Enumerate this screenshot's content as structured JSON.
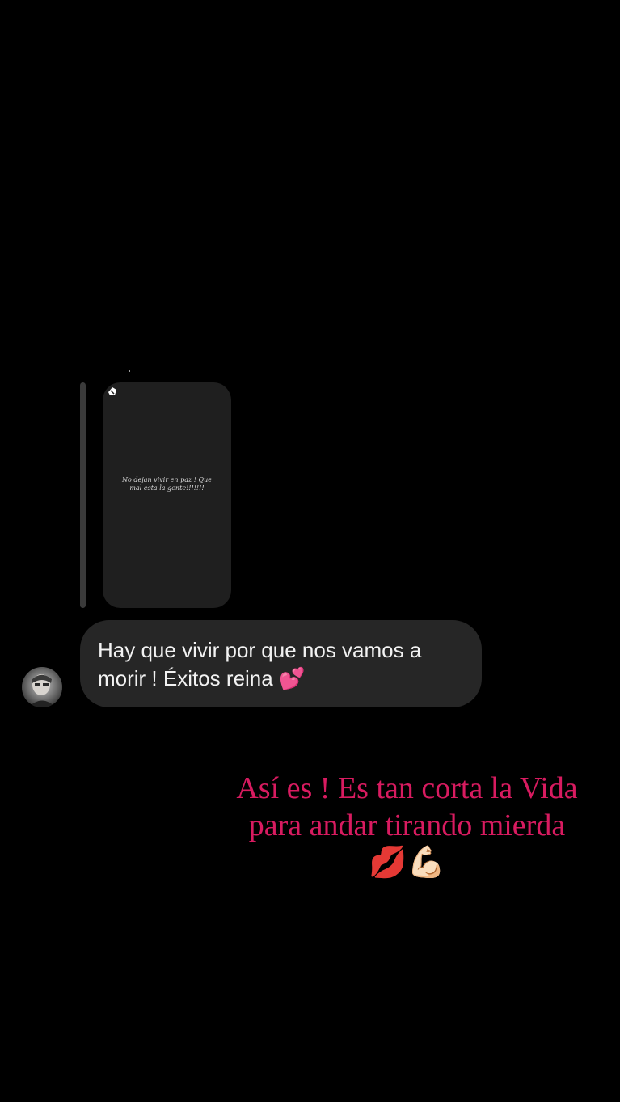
{
  "replied_story": {
    "text": "No dejan vivir en paz ! Que mal esta la gente!!!!!!!"
  },
  "message": {
    "text": "Hay que vivir por que nos vamos a morir ! Éxitos reina 💕"
  },
  "story_overlay": {
    "text": "Así es ! Es tan corta la Vida para andar tirando mierda💋💪🏻"
  },
  "colors": {
    "background": "#000000",
    "bubble": "#262626",
    "story_card": "#1f1f1f",
    "overlay_text": "#d81b60"
  }
}
